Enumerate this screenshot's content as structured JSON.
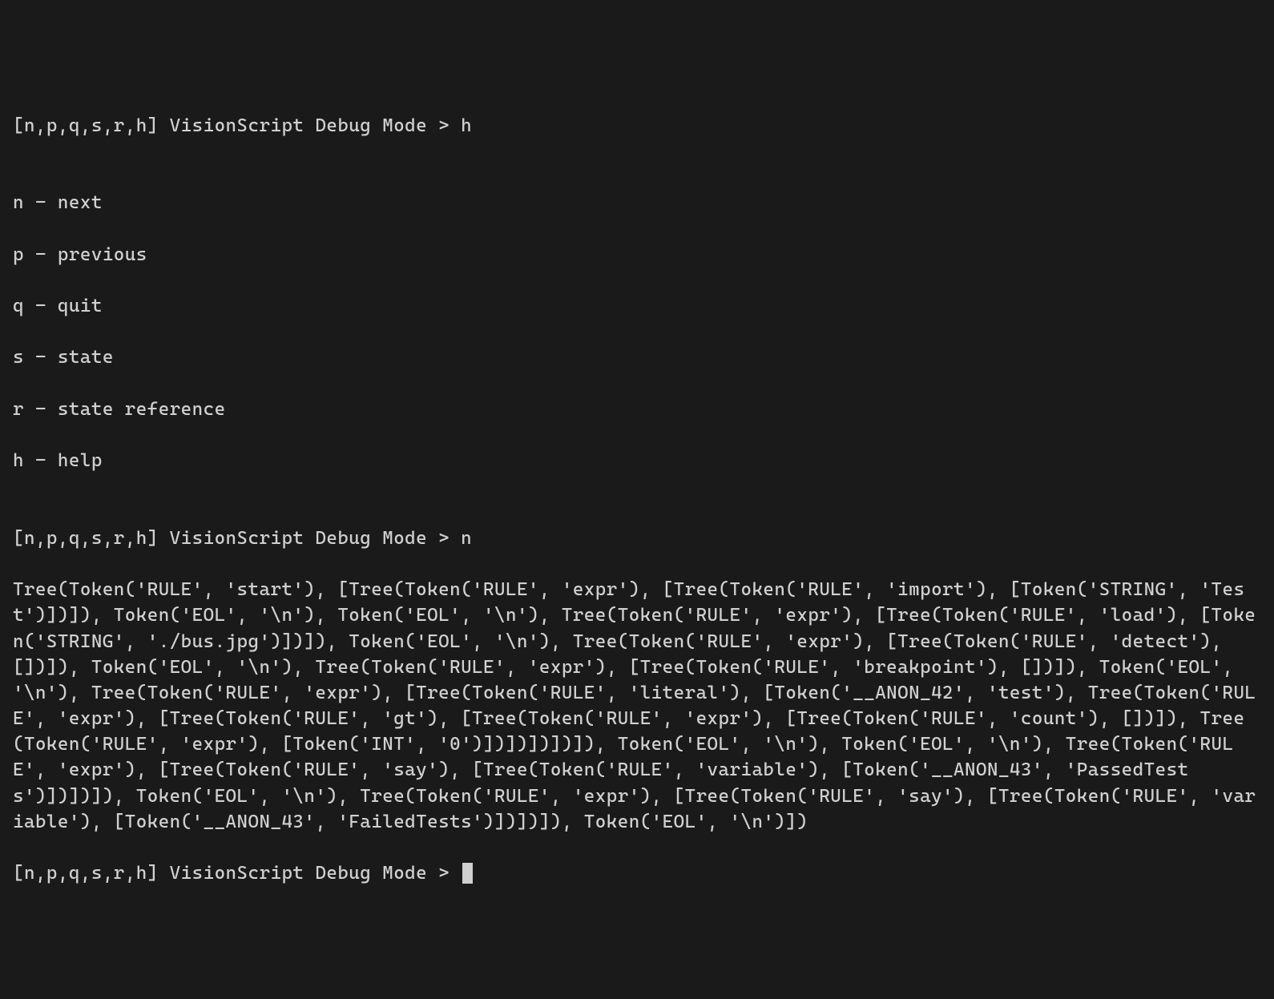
{
  "prompt1": "[n,p,q,s,r,h] VisionScript Debug Mode > h",
  "blank1": "",
  "help_n": "n - next",
  "help_p": "p - previous",
  "help_q": "q - quit",
  "help_s": "s - state",
  "help_r": "r - state reference",
  "help_h": "h - help",
  "blank2": "",
  "prompt2": "[n,p,q,s,r,h] VisionScript Debug Mode > n",
  "tree_output": "Tree(Token('RULE', 'start'), [Tree(Token('RULE', 'expr'), [Tree(Token('RULE', 'import'), [Token('STRING', 'Test')])]), Token('EOL', '\\n'), Token('EOL', '\\n'), Tree(Token('RULE', 'expr'), [Tree(Token('RULE', 'load'), [Token('STRING', './bus.jpg')])]), Token('EOL', '\\n'), Tree(Token('RULE', 'expr'), [Tree(Token('RULE', 'detect'), [])]), Token('EOL', '\\n'), Tree(Token('RULE', 'expr'), [Tree(Token('RULE', 'breakpoint'), [])]), Token('EOL', '\\n'), Tree(Token('RULE', 'expr'), [Tree(Token('RULE', 'literal'), [Token('__ANON_42', 'test'), Tree(Token('RULE', 'expr'), [Tree(Token('RULE', 'gt'), [Tree(Token('RULE', 'expr'), [Tree(Token('RULE', 'count'), [])]), Tree(Token('RULE', 'expr'), [Token('INT', '0')])])])])]), Token('EOL', '\\n'), Token('EOL', '\\n'), Tree(Token('RULE', 'expr'), [Tree(Token('RULE', 'say'), [Tree(Token('RULE', 'variable'), [Token('__ANON_43', 'PassedTests')])])]), Token('EOL', '\\n'), Tree(Token('RULE', 'expr'), [Tree(Token('RULE', 'say'), [Tree(Token('RULE', 'variable'), [Token('__ANON_43', 'FailedTests')])])]), Token('EOL', '\\n')])",
  "prompt3": "[n,p,q,s,r,h] VisionScript Debug Mode > "
}
